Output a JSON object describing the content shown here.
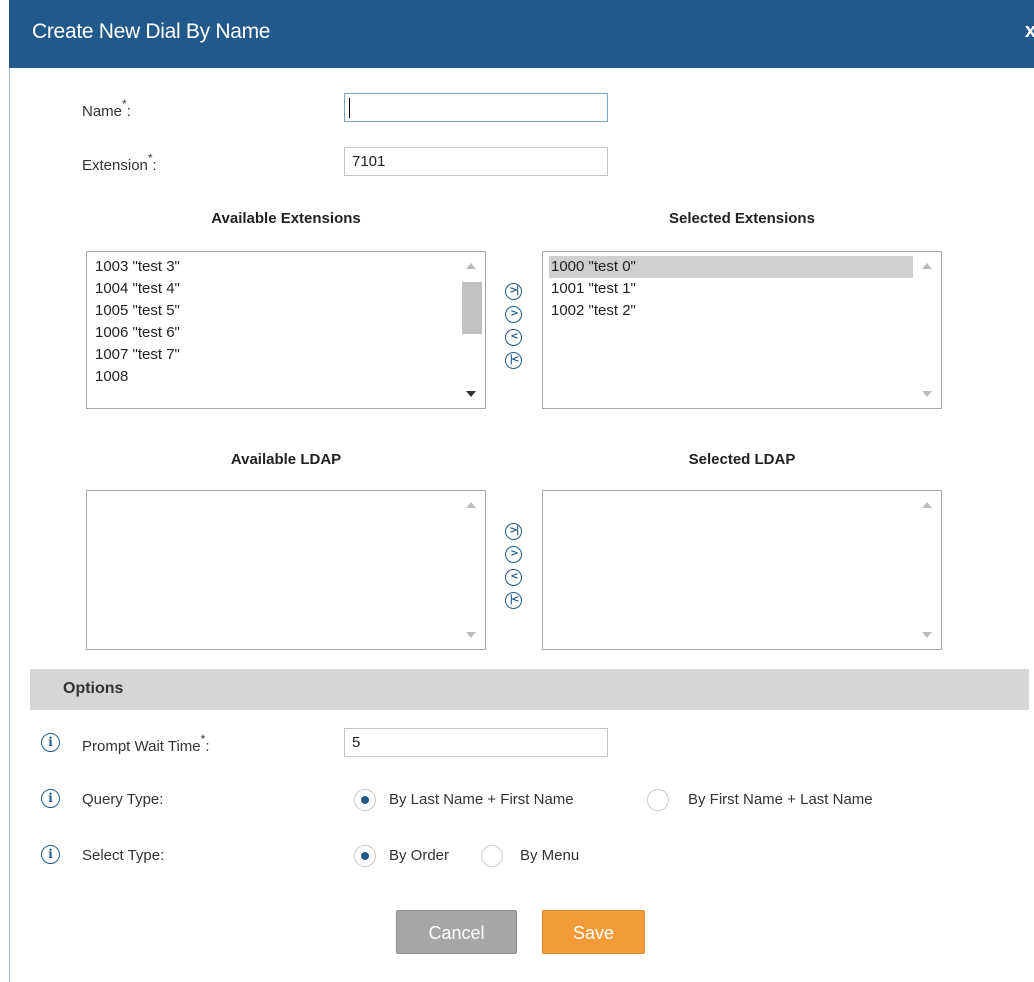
{
  "dialog": {
    "title": "Create New Dial By Name",
    "close_label": "x"
  },
  "form": {
    "name_label": "Name",
    "name_value": "",
    "extension_label": "Extension",
    "extension_value": "7101",
    "required_mark": "*",
    "colon": ":"
  },
  "extensions": {
    "available_title": "Available Extensions",
    "selected_title": "Selected Extensions",
    "available_items": [
      "1003 \"test 3\"",
      "1004 \"test 4\"",
      "1005 \"test 5\"",
      "1006 \"test 6\"",
      "1007 \"test 7\"",
      "1008"
    ],
    "selected_items": [
      "1000 \"test 0\"",
      "1001 \"test 1\"",
      "1002 \"test 2\""
    ]
  },
  "ldap": {
    "available_title": "Available LDAP",
    "selected_title": "Selected LDAP"
  },
  "transfer_buttons": [
    "add-all",
    "add",
    "remove",
    "remove-all"
  ],
  "options": {
    "section_title": "Options",
    "prompt_wait_label": "Prompt Wait Time",
    "prompt_wait_value": "5",
    "query_type_label": "Query Type:",
    "query_type_options": [
      "By Last Name + First Name",
      "By First Name + Last Name"
    ],
    "query_type_selected": "By Last Name + First Name",
    "select_type_label": "Select Type:",
    "select_type_options": [
      "By Order",
      "By Menu"
    ],
    "select_type_selected": "By Order"
  },
  "buttons": {
    "cancel": "Cancel",
    "save": "Save"
  },
  "colors": {
    "header": "#215a8a",
    "save": "#f39b38",
    "cancel": "#a6a6a6",
    "options_bar": "#d6d6d6"
  }
}
